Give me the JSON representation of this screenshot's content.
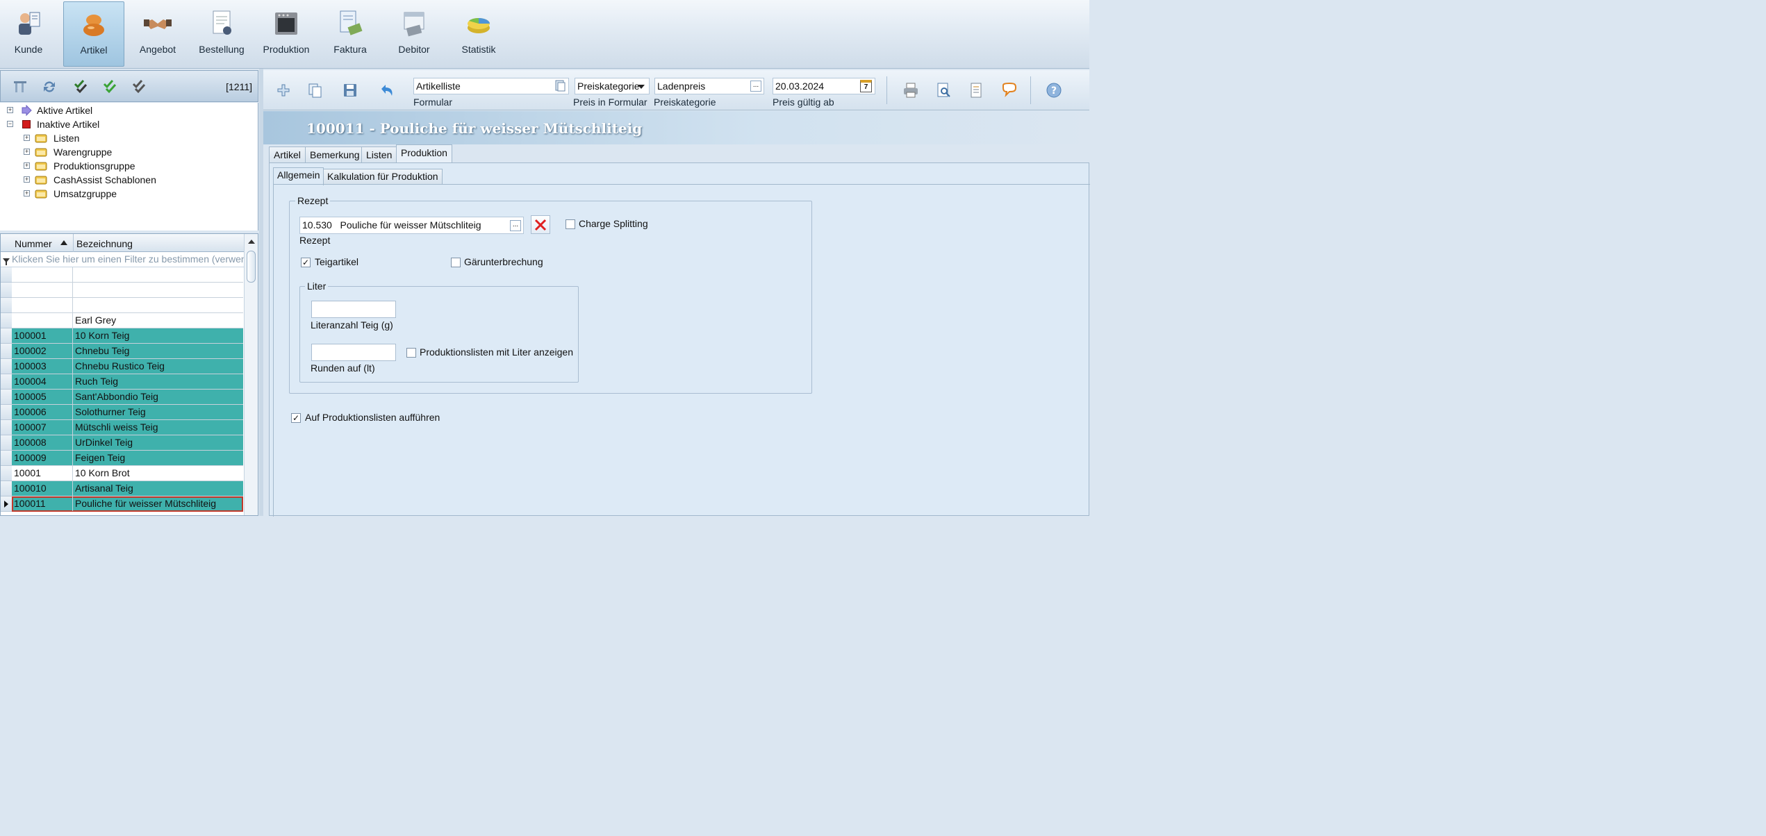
{
  "ribbon": {
    "items": [
      {
        "label": "Kunde",
        "icon": "customer-icon",
        "active": false
      },
      {
        "label": "Artikel",
        "icon": "bread-icon",
        "active": true
      },
      {
        "label": "Angebot",
        "icon": "handshake-icon",
        "active": false
      },
      {
        "label": "Bestellung",
        "icon": "order-document-icon",
        "active": false
      },
      {
        "label": "Produktion",
        "icon": "oven-icon",
        "active": false
      },
      {
        "label": "Faktura",
        "icon": "invoice-icon",
        "active": false
      },
      {
        "label": "Debitor",
        "icon": "calendar-money-icon",
        "active": false
      },
      {
        "label": "Statistik",
        "icon": "pie-chart-icon",
        "active": false
      }
    ]
  },
  "nav": {
    "count": "[1211]",
    "tree": {
      "active": "Aktive Artikel",
      "inactive": "Inaktive Artikel",
      "children": [
        "Listen",
        "Warengruppe",
        "Produktionsgruppe",
        "CashAssist Schablonen",
        "Umsatzgruppe"
      ]
    }
  },
  "grid": {
    "col_number": "Nummer",
    "col_name": "Bezeichnung",
    "filter_hint": "Klicken Sie hier um einen Filter zu bestimmen (verwenden",
    "rows": [
      {
        "num": "",
        "name": ""
      },
      {
        "num": "",
        "name": ""
      },
      {
        "num": "",
        "name": ""
      },
      {
        "num": "",
        "name": "Earl Grey"
      },
      {
        "num": "100001",
        "name": "10 Korn Teig"
      },
      {
        "num": "100002",
        "name": "Chnebu Teig"
      },
      {
        "num": "100003",
        "name": "Chnebu Rustico Teig"
      },
      {
        "num": "100004",
        "name": "Ruch Teig"
      },
      {
        "num": "100005",
        "name": "Sant'Abbondio Teig"
      },
      {
        "num": "100006",
        "name": "Solothurner Teig"
      },
      {
        "num": "100007",
        "name": "Mütschli weiss Teig"
      },
      {
        "num": "100008",
        "name": "UrDinkel Teig"
      },
      {
        "num": "100009",
        "name": "Feigen Teig"
      },
      {
        "num": "10001",
        "name": "10 Korn Brot"
      },
      {
        "num": "100010",
        "name": "Artisanal Teig"
      },
      {
        "num": "100011",
        "name": "Pouliche für weisser Mütschliteig"
      }
    ]
  },
  "toolbar": {
    "formular_value": "Artikelliste",
    "formular_label": "Formular",
    "preis_in_formular_value": "Preiskategorie",
    "preis_in_formular_label": "Preis in Formular",
    "preiskategorie_value": "Ladenpreis",
    "preiskategorie_label": "Preiskategorie",
    "date_value": "20.03.2024",
    "date_label": "Preis gültig ab",
    "calendar_day": "7"
  },
  "detail": {
    "title": "100011 - Pouliche für weisser Mütschliteig",
    "tabs": [
      "Artikel",
      "Bemerkung",
      "Listen",
      "Produktion"
    ],
    "subtabs": [
      "Allgemein",
      "Kalkulation für Produktion"
    ],
    "rezept_group": "Rezept",
    "rezept_value": "10.530   Pouliche für weisser Mütschliteig",
    "rezept_label": "Rezept",
    "charge_splitting": "Charge Splitting",
    "teigartikel": "Teigartikel",
    "gaerunterbrechung": "Gärunterbrechung",
    "liter_group": "Liter",
    "literanzahl_label": "Literanzahl Teig (g)",
    "runden_label": "Runden auf (lt)",
    "produktionslisten_liter": "Produktionslisten mit Liter anzeigen",
    "auf_produktionslisten": "Auf Produktionslisten aufführen"
  }
}
